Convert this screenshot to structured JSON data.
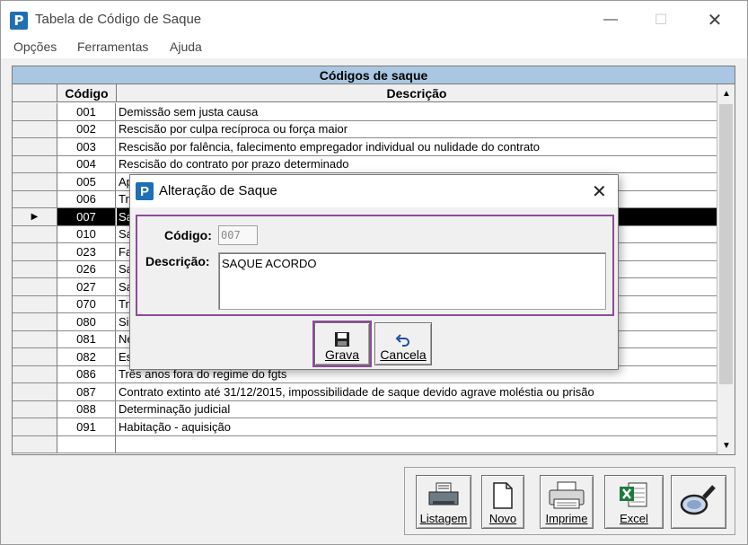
{
  "window": {
    "title": "Tabela de Código de Saque",
    "app_icon_letter": "P",
    "minimize_glyph": "—",
    "maximize_glyph": "☐",
    "close_glyph": "✕"
  },
  "menu": [
    "Opções",
    "Ferramentas",
    "Ajuda"
  ],
  "grid": {
    "caption": "Códigos de saque",
    "col_code": "Código",
    "col_desc": "Descrição",
    "rows": [
      {
        "code": "001",
        "desc": "Demissão sem justa causa"
      },
      {
        "code": "002",
        "desc": "Rescisão por culpa recíproca ou força maior"
      },
      {
        "code": "003",
        "desc": "Rescisão por falência, falecimento empregador individual ou nulidade do contrato"
      },
      {
        "code": "004",
        "desc": "Rescisão do contrato por prazo determinado"
      },
      {
        "code": "005",
        "desc": "Ap"
      },
      {
        "code": "006",
        "desc": "Tr"
      },
      {
        "code": "007",
        "desc": "Sa"
      },
      {
        "code": "010",
        "desc": "Sa"
      },
      {
        "code": "023",
        "desc": "Fa"
      },
      {
        "code": "026",
        "desc": "Sa"
      },
      {
        "code": "027",
        "desc": "Sa"
      },
      {
        "code": "070",
        "desc": "Tr"
      },
      {
        "code": "080",
        "desc": "Si"
      },
      {
        "code": "081",
        "desc": "Ne"
      },
      {
        "code": "082",
        "desc": "Es"
      },
      {
        "code": "086",
        "desc": "Três anos fora do regime do fgts"
      },
      {
        "code": "087",
        "desc": "Contrato extinto até 31/12/2015, impossibilidade de saque devido agrave moléstia ou prisão"
      },
      {
        "code": "088",
        "desc": "Determinação judicial"
      },
      {
        "code": "091",
        "desc": "Habitação - aquisição"
      },
      {
        "code": "",
        "desc": ""
      }
    ],
    "selected_index": 6,
    "indicator_glyph": "▶"
  },
  "toolbar": {
    "listagem": "Listagem",
    "novo": "Novo",
    "imprime": "Imprime",
    "excel": "Excel"
  },
  "dialog": {
    "title": "Alteração de Saque",
    "icon_letter": "P",
    "close_glyph": "✕",
    "code_label": "Código:",
    "code_value": "007",
    "desc_label": "Descrição:",
    "desc_value": "SAQUE ACORDO",
    "save_label": "Grava",
    "cancel_label": "Cancela"
  },
  "colors": {
    "caption_bg": "#a9c7e2",
    "highlight": "#8e4b9b",
    "app_blue": "#1f6fb5",
    "selected_row": "#000000"
  },
  "icons": [
    "printer-list-icon",
    "new-document-icon",
    "printer-icon",
    "excel-icon",
    "magnifier-icon",
    "floppy-disk-icon",
    "undo-arrow-icon"
  ]
}
